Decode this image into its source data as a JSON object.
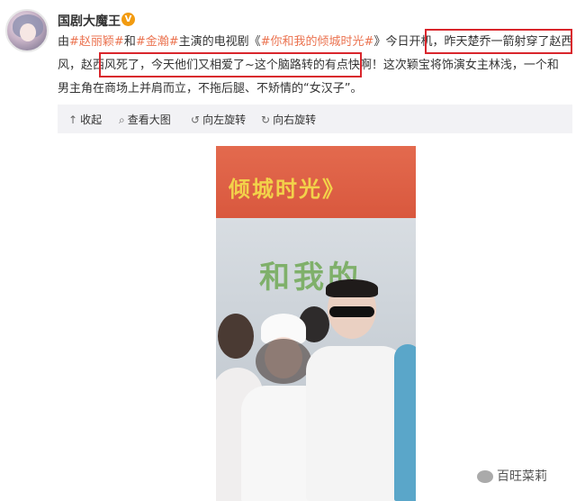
{
  "user": {
    "name": "国剧大魔王",
    "badge": "V"
  },
  "post": {
    "line1": {
      "p1": "由",
      "m1": "#赵丽颖#",
      "p2": "和",
      "m2": "#金瀚#",
      "p3": "主演的电视剧《",
      "m3": "#你和我的倾城时光#",
      "p4": "》今日开机，",
      "hl": "昨天楚乔一箭射穿了赵西"
    },
    "line2": {
      "hl": "风，赵西风死了，今天他们又相爱了~这个脑路转的有点快啊！",
      "rest": "这次颖宝将饰演女主林浅，一个和"
    },
    "line3": "男主角在商场上并肩而立，不拖后腿、不矫情的“女汉子”。"
  },
  "toolbar": {
    "collapse": "收起",
    "view_large": "查看大图",
    "rotate_left": "向左旋转",
    "rotate_right": "向右旋转"
  },
  "photo": {
    "banner_text": "倾城时光》",
    "backdrop_text": "和我的"
  },
  "watermark": {
    "text": "百旺菜莉"
  },
  "colors": {
    "highlight_box": "#d9262c",
    "link": "#eb7350",
    "badge": "#f29b10"
  }
}
